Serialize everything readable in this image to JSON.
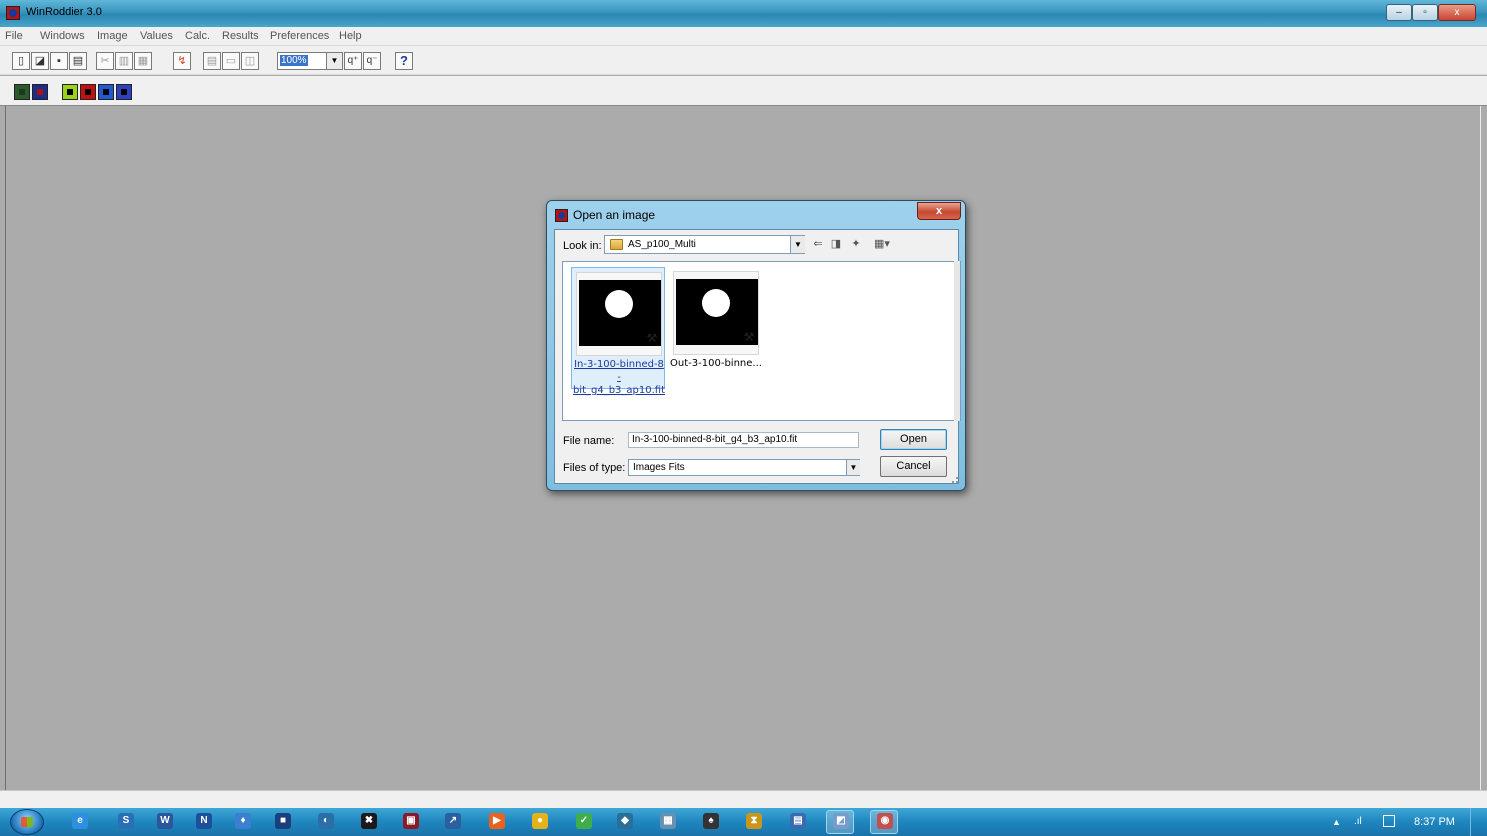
{
  "window": {
    "title": "WinRoddier 3.0",
    "minimize_glyph": "–",
    "maximize_glyph": "▫",
    "close_glyph": "x"
  },
  "menu": [
    "File",
    "Windows",
    "Image",
    "Values",
    "Calc.",
    "Results",
    "Preferences",
    "Help"
  ],
  "toolbar": {
    "zoom": "100%",
    "tools": [
      "new-icon",
      "open-icon",
      "save-icon",
      "print-icon",
      "cut-icon",
      "copy-icon",
      "paste-icon",
      "refresh-icon",
      "tile-icon",
      "tile-horizontal-icon",
      "tile-vertical-icon",
      "zoom-in-icon",
      "zoom-out-icon",
      "help-icon"
    ],
    "help_glyph": "?",
    "zoom_in_glyph": "q⁺",
    "zoom_out_glyph": "q⁻"
  },
  "toolbar2": {
    "tools": [
      "image-tool-1-icon",
      "image-tool-2-icon",
      "image-tool-3-icon",
      "image-tool-4-icon",
      "image-tool-5-icon",
      "image-tool-6-icon"
    ],
    "colors": [
      "#2c5a2c",
      "#1a2f8a",
      "#9ad41a",
      "#c01010",
      "#1f5ad0",
      "#2f3fbf"
    ]
  },
  "dialog": {
    "title": "Open an image",
    "close_glyph": "x",
    "look_in_label": "Look in:",
    "look_in_value": "AS_p100_Multi",
    "files": [
      {
        "name_line1": "In-3-100-binned-8",
        "name_line2": "-bit_g4_b3_ap10.fit",
        "selected": true
      },
      {
        "name_line1": "Out-3-100-binne...",
        "name_line2": "",
        "selected": false
      }
    ],
    "file_name_label": "File name:",
    "file_name_value": "In-3-100-binned-8-bit_g4_b3_ap10.fit",
    "files_of_type_label": "Files of type:",
    "files_of_type_value": "Images Fits",
    "open_button": "Open",
    "cancel_button": "Cancel"
  },
  "taskbar": {
    "icons": [
      {
        "name": "ie-icon",
        "glyph": "e",
        "color": "#2d8fe0"
      },
      {
        "name": "app-2-icon",
        "glyph": "S",
        "color": "#2a6fb5"
      },
      {
        "name": "word-icon",
        "glyph": "W",
        "color": "#2b579a"
      },
      {
        "name": "app-4-icon",
        "glyph": "N",
        "color": "#1d4f9a"
      },
      {
        "name": "app-5-icon",
        "glyph": "♦",
        "color": "#3a7fd0"
      },
      {
        "name": "app-6-icon",
        "glyph": "■",
        "color": "#1b3f7a"
      },
      {
        "name": "app-7-icon",
        "glyph": "◐",
        "color": "#2b6fa8"
      },
      {
        "name": "app-8-icon",
        "glyph": "✖",
        "color": "#1a1a1a"
      },
      {
        "name": "app-9-icon",
        "glyph": "▣",
        "color": "#8a1a2a"
      },
      {
        "name": "app-10-icon",
        "glyph": "↗",
        "color": "#2a5fa0"
      },
      {
        "name": "media-player-icon",
        "glyph": "▶",
        "color": "#e8641e"
      },
      {
        "name": "app-12-icon",
        "glyph": "●",
        "color": "#e6b21a"
      },
      {
        "name": "app-13-icon",
        "glyph": "✓",
        "color": "#3fae4a"
      },
      {
        "name": "app-14-icon",
        "glyph": "◆",
        "color": "#2a6f9a"
      },
      {
        "name": "app-15-icon",
        "glyph": "▦",
        "color": "#6a8fb0"
      },
      {
        "name": "app-16-icon",
        "glyph": "♠",
        "color": "#333333"
      },
      {
        "name": "app-17-icon",
        "glyph": "⧗",
        "color": "#c9961a"
      },
      {
        "name": "app-18-icon",
        "glyph": "▤",
        "color": "#3a6ab0"
      },
      {
        "name": "app-19-icon",
        "glyph": "◩",
        "color": "#4a7ab8"
      },
      {
        "name": "winroddier-taskbar-icon",
        "glyph": "◉",
        "color": "#b01515"
      }
    ],
    "tray_arrow": "▲",
    "tray_signal": ".ıl",
    "clock": "8:37 PM"
  }
}
